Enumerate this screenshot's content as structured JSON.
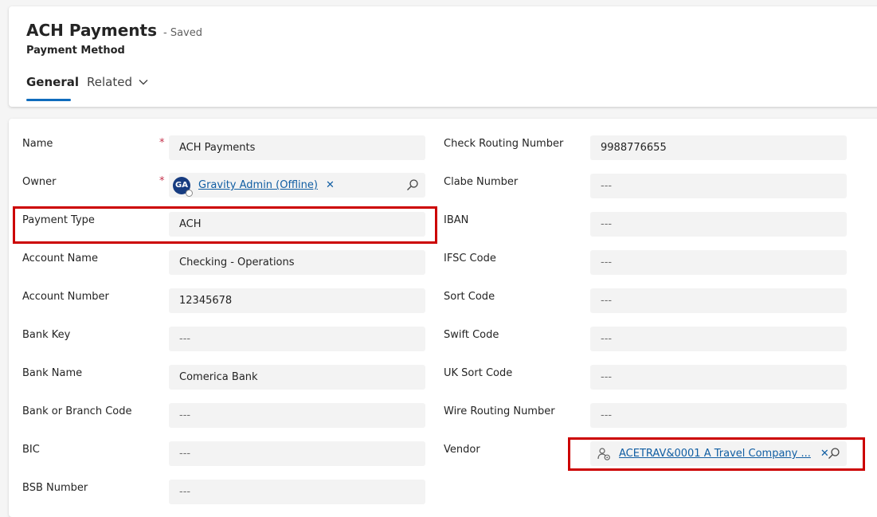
{
  "header": {
    "title": "ACH Payments",
    "status": "- Saved",
    "entity": "Payment Method",
    "tabs": {
      "general": "General",
      "related": "Related"
    }
  },
  "left_fields": {
    "name": {
      "label": "Name",
      "value": "ACH Payments"
    },
    "owner": {
      "label": "Owner",
      "avatar": "GA",
      "value": "Gravity Admin (Offline)"
    },
    "payment_type": {
      "label": "Payment Type",
      "value": "ACH"
    },
    "account_name": {
      "label": "Account Name",
      "value": "Checking - Operations"
    },
    "account_number": {
      "label": "Account Number",
      "value": "12345678"
    },
    "bank_key": {
      "label": "Bank Key",
      "value": "---"
    },
    "bank_name": {
      "label": "Bank Name",
      "value": "Comerica Bank"
    },
    "bank_branch_code": {
      "label": "Bank or Branch Code",
      "value": "---"
    },
    "bic": {
      "label": "BIC",
      "value": "---"
    },
    "bsb_number": {
      "label": "BSB Number",
      "value": "---"
    }
  },
  "right_fields": {
    "check_routing": {
      "label": "Check Routing Number",
      "value": "9988776655"
    },
    "clabe": {
      "label": "Clabe Number",
      "value": "---"
    },
    "iban": {
      "label": "IBAN",
      "value": "---"
    },
    "ifsc": {
      "label": "IFSC Code",
      "value": "---"
    },
    "sort_code": {
      "label": "Sort Code",
      "value": "---"
    },
    "swift": {
      "label": "Swift Code",
      "value": "---"
    },
    "uk_sort": {
      "label": "UK Sort Code",
      "value": "---"
    },
    "wire_routing": {
      "label": "Wire Routing Number",
      "value": "---"
    },
    "vendor": {
      "label": "Vendor",
      "value": "ACETRAV&0001 A Travel Company ..."
    }
  },
  "required_marker": "*",
  "remove_glyph": "✕",
  "icons": [
    "chevron-down-icon",
    "search-icon",
    "close-icon",
    "vendor-entity-icon",
    "avatar"
  ],
  "colors": {
    "accent": "#0f6cbd",
    "link": "#115ea3",
    "required": "#c4314b",
    "highlight": "#cc0000"
  }
}
